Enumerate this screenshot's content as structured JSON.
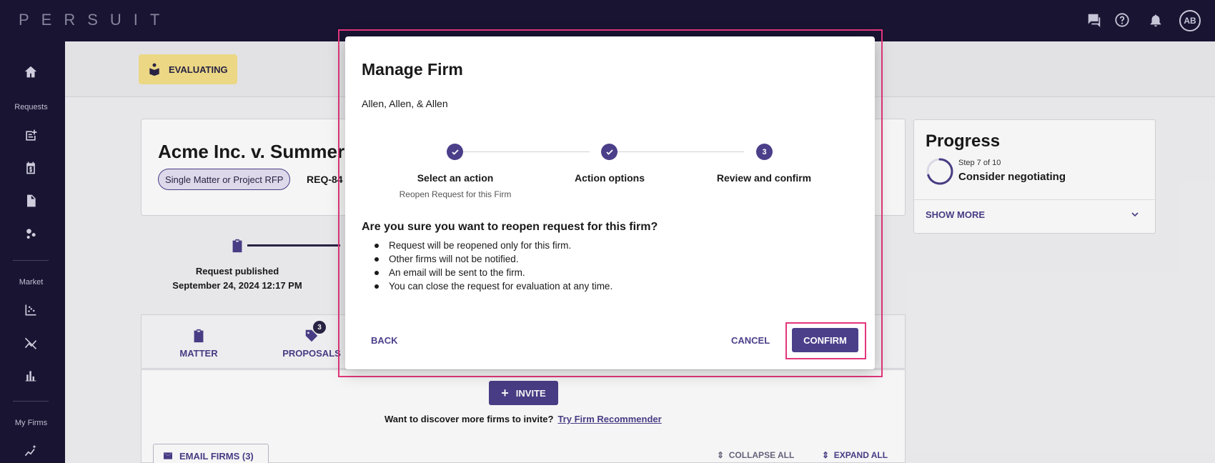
{
  "app": {
    "logo": "PERSUIT",
    "avatar_initials": "AB"
  },
  "topbar": {
    "icons": [
      "chat-icon",
      "help-icon",
      "bell-icon"
    ]
  },
  "sidebar": {
    "sections": [
      {
        "label": "Requests",
        "icons": [
          "add-request-icon",
          "billing-icon",
          "document-icon",
          "share-icon"
        ]
      },
      {
        "label": "Market",
        "icons": [
          "scatter-chart-icon",
          "analytics-icon",
          "bar-chart-icon"
        ]
      },
      {
        "label": "My Firms",
        "icons": [
          "sparkle-chart-icon"
        ]
      }
    ]
  },
  "status": {
    "label": "EVALUATING"
  },
  "request": {
    "title": "Acme Inc. v. Summer",
    "type_chip": "Single Matter or Project RFP",
    "id": "REQ-84"
  },
  "timeline": {
    "event": "Request published",
    "date": "September 24, 2024 12:17 PM"
  },
  "tabs": [
    {
      "label": "MATTER"
    },
    {
      "label": "PROPOSALS",
      "badge": "3"
    }
  ],
  "lower": {
    "invite_label": "INVITE",
    "discover_text": "Want to discover more firms to invite?",
    "discover_link": "Try Firm Recommender",
    "email_label": "EMAIL FIRMS (3)",
    "collapse_label": "COLLAPSE ALL",
    "expand_label": "EXPAND ALL"
  },
  "progress": {
    "title": "Progress",
    "step_text": "Step 7 of 10",
    "fraction": 0.7,
    "next": "Consider negotiating",
    "show_more": "SHOW MORE"
  },
  "modal": {
    "title": "Manage Firm",
    "firm": "Allen, Allen, & Allen",
    "steps": [
      {
        "label": "Select an action",
        "sub": "Reopen Request for this Firm",
        "state": "done"
      },
      {
        "label": "Action options",
        "sub": "",
        "state": "done"
      },
      {
        "label": "Review and confirm",
        "sub": "",
        "state": "current",
        "number": "3"
      }
    ],
    "question": "Are you sure you want to reopen request for this firm?",
    "bullets": [
      "Request will be reopened only for this firm.",
      "Other firms will not be notified.",
      "An email will be sent to the firm.",
      "You can close the request for evaluation at any time."
    ],
    "back_label": "BACK",
    "cancel_label": "CANCEL",
    "confirm_label": "CONFIRM"
  },
  "colors": {
    "brand": "#4b3f8a",
    "nav": "#1a1535",
    "status": "#f5e08a",
    "highlight": "#e4367c"
  }
}
